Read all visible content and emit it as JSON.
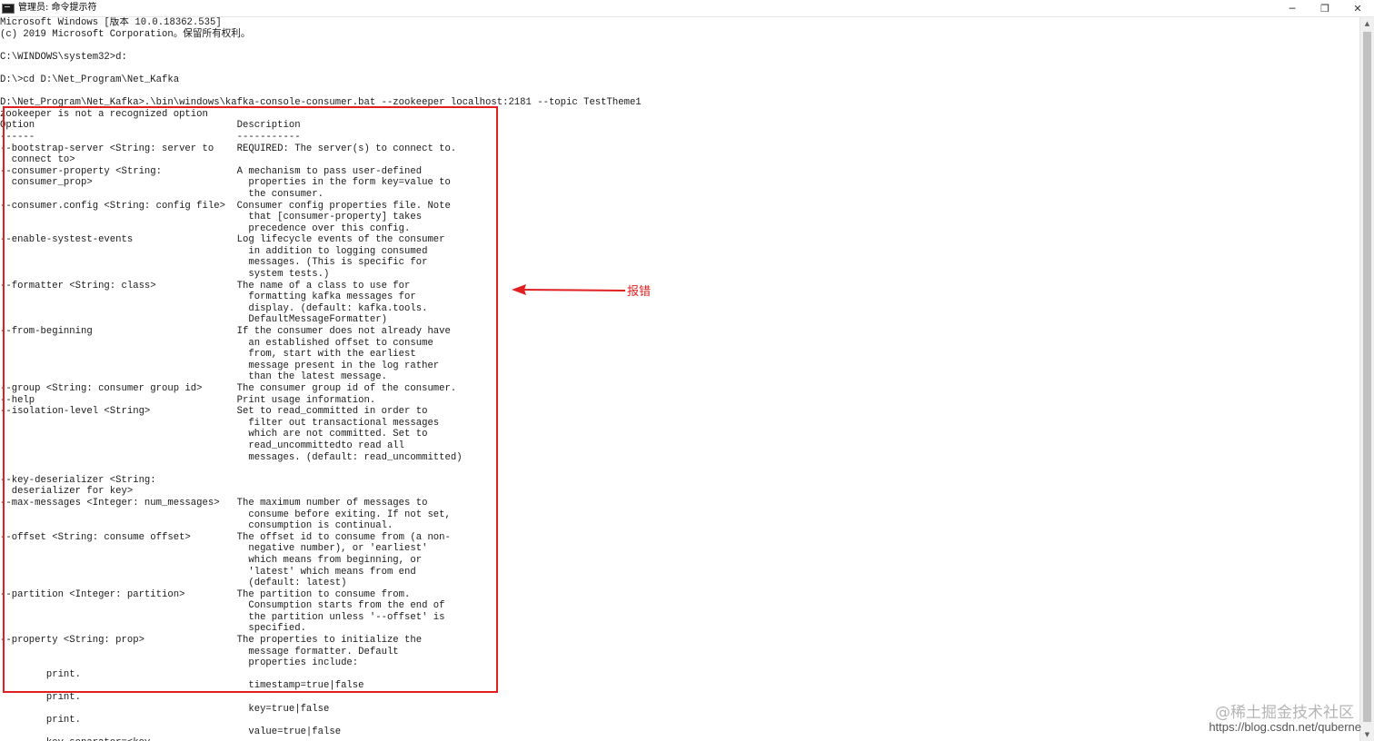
{
  "window": {
    "title": "管理员: 命令提示符",
    "controls": {
      "minimize": "─",
      "maximize": "❐",
      "close": "✕"
    }
  },
  "console": {
    "lines": [
      "Microsoft Windows [版本 10.0.18362.535]",
      "(c) 2019 Microsoft Corporation。保留所有权利。",
      "",
      "C:\\WINDOWS\\system32>d:",
      "",
      "D:\\>cd D:\\Net_Program\\Net_Kafka",
      "",
      "D:\\Net_Program\\Net_Kafka>.\\bin\\windows\\kafka-console-consumer.bat --zookeeper localhost:2181 --topic TestTheme1",
      "zookeeper is not a recognized option",
      "Option                                   Description",
      "------                                   -----------",
      "--bootstrap-server <String: server to    REQUIRED: The server(s) to connect to.",
      "  connect to>",
      "--consumer-property <String:             A mechanism to pass user-defined",
      "  consumer_prop>                           properties in the form key=value to",
      "                                           the consumer.",
      "--consumer.config <String: config file>  Consumer config properties file. Note",
      "                                           that [consumer-property] takes",
      "                                           precedence over this config.",
      "--enable-systest-events                  Log lifecycle events of the consumer",
      "                                           in addition to logging consumed",
      "                                           messages. (This is specific for",
      "                                           system tests.)",
      "--formatter <String: class>              The name of a class to use for",
      "                                           formatting kafka messages for",
      "                                           display. (default: kafka.tools.",
      "                                           DefaultMessageFormatter)",
      "--from-beginning                         If the consumer does not already have",
      "                                           an established offset to consume",
      "                                           from, start with the earliest",
      "                                           message present in the log rather",
      "                                           than the latest message.",
      "--group <String: consumer group id>      The consumer group id of the consumer.",
      "--help                                   Print usage information.",
      "--isolation-level <String>               Set to read_committed in order to",
      "                                           filter out transactional messages",
      "                                           which are not committed. Set to",
      "                                           read_uncommittedto read all",
      "                                           messages. (default: read_uncommitted)",
      "",
      "--key-deserializer <String:",
      "  deserializer for key>",
      "--max-messages <Integer: num_messages>   The maximum number of messages to",
      "                                           consume before exiting. If not set,",
      "                                           consumption is continual.",
      "--offset <String: consume offset>        The offset id to consume from (a non-",
      "                                           negative number), or 'earliest'",
      "                                           which means from beginning, or",
      "                                           'latest' which means from end",
      "                                           (default: latest)",
      "--partition <Integer: partition>         The partition to consume from.",
      "                                           Consumption starts from the end of",
      "                                           the partition unless '--offset' is",
      "                                           specified.",
      "--property <String: prop>                The properties to initialize the",
      "                                           message formatter. Default",
      "                                           properties include:",
      "        print.",
      "                                           timestamp=true|false",
      "        print.",
      "                                           key=true|false",
      "        print.",
      "                                           value=true|false",
      "        key.separator=<key."
    ]
  },
  "annotation": {
    "label": "报错",
    "color": "#e02020"
  },
  "watermark": {
    "site": "@稀土掘金技术社区",
    "url": "https://blog.csdn.net/quberne"
  }
}
